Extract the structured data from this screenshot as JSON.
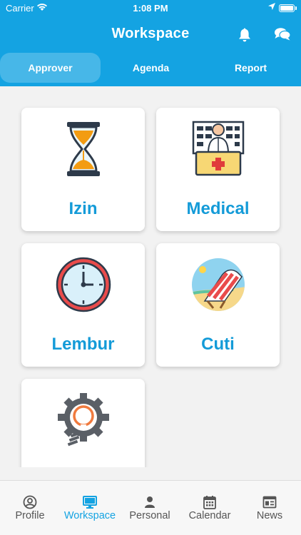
{
  "status_bar": {
    "carrier": "Carrier",
    "time": "1:08 PM"
  },
  "header": {
    "title": "Workspace",
    "icons": [
      "bell-icon",
      "chat-icon"
    ],
    "color": "#14a3e2"
  },
  "tabs": [
    {
      "label": "Approver",
      "active": true
    },
    {
      "label": "Agenda",
      "active": false
    },
    {
      "label": "Report",
      "active": false
    }
  ],
  "cards": [
    {
      "label": "Izin",
      "icon": "hourglass-icon"
    },
    {
      "label": "Medical",
      "icon": "doctor-icon"
    },
    {
      "label": "Lembur",
      "icon": "clock-icon"
    },
    {
      "label": "Cuti",
      "icon": "beach-chair-icon"
    },
    {
      "label": "",
      "icon": "gear-bulb-icon"
    }
  ],
  "bottom_nav": [
    {
      "label": "Profile",
      "icon": "profile-icon",
      "active": false
    },
    {
      "label": "Workspace",
      "icon": "monitor-icon",
      "active": true
    },
    {
      "label": "Personal",
      "icon": "person-icon",
      "active": false
    },
    {
      "label": "Calendar",
      "icon": "calendar-icon",
      "active": false
    },
    {
      "label": "News",
      "icon": "news-icon",
      "active": false
    }
  ],
  "colors": {
    "accent": "#14a3e2",
    "card_label": "#149bd8",
    "background": "#f2f2f2"
  }
}
